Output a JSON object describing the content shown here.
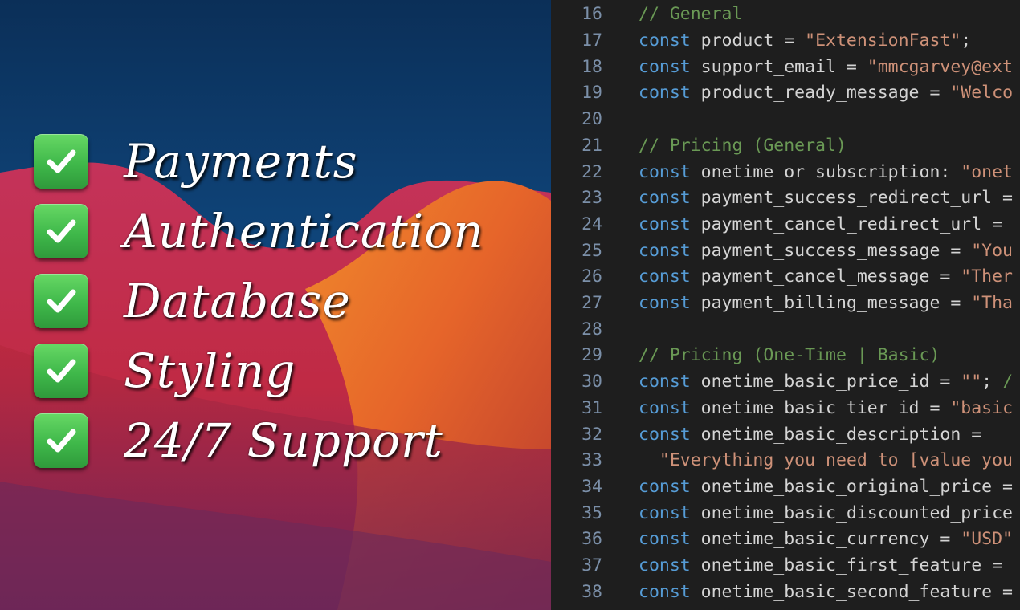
{
  "promo": {
    "features": [
      {
        "label": "Payments",
        "checked": true
      },
      {
        "label": "Authentication",
        "checked": true
      },
      {
        "label": "Database",
        "checked": true
      },
      {
        "label": "Styling",
        "checked": true
      },
      {
        "label": "24/7 Support",
        "checked": true
      }
    ],
    "check_color": "#4cc552"
  },
  "editor": {
    "lines": [
      {
        "num": "16",
        "tokens": [
          {
            "t": "com",
            "v": "// General"
          }
        ]
      },
      {
        "num": "17",
        "tokens": [
          {
            "t": "kw",
            "v": "const "
          },
          {
            "t": "id",
            "v": "product = "
          },
          {
            "t": "str",
            "v": "\"ExtensionFast\""
          },
          {
            "t": "punc",
            "v": ";"
          }
        ]
      },
      {
        "num": "18",
        "tokens": [
          {
            "t": "kw",
            "v": "const "
          },
          {
            "t": "id",
            "v": "support_email = "
          },
          {
            "t": "str",
            "v": "\"mmcgarvey@ext"
          }
        ]
      },
      {
        "num": "19",
        "tokens": [
          {
            "t": "kw",
            "v": "const "
          },
          {
            "t": "id",
            "v": "product_ready_message = "
          },
          {
            "t": "str",
            "v": "\"Welco"
          }
        ]
      },
      {
        "num": "20",
        "tokens": []
      },
      {
        "num": "21",
        "tokens": [
          {
            "t": "com",
            "v": "// Pricing (General)"
          }
        ]
      },
      {
        "num": "22",
        "tokens": [
          {
            "t": "kw",
            "v": "const "
          },
          {
            "t": "id",
            "v": "onetime_or_subscription: "
          },
          {
            "t": "str",
            "v": "\"onet"
          }
        ]
      },
      {
        "num": "23",
        "tokens": [
          {
            "t": "kw",
            "v": "const "
          },
          {
            "t": "id",
            "v": "payment_success_redirect_url ="
          }
        ]
      },
      {
        "num": "24",
        "tokens": [
          {
            "t": "kw",
            "v": "const "
          },
          {
            "t": "id",
            "v": "payment_cancel_redirect_url = "
          }
        ]
      },
      {
        "num": "25",
        "tokens": [
          {
            "t": "kw",
            "v": "const "
          },
          {
            "t": "id",
            "v": "payment_success_message = "
          },
          {
            "t": "str",
            "v": "\"You"
          }
        ]
      },
      {
        "num": "26",
        "tokens": [
          {
            "t": "kw",
            "v": "const "
          },
          {
            "t": "id",
            "v": "payment_cancel_message = "
          },
          {
            "t": "str",
            "v": "\"Ther"
          }
        ]
      },
      {
        "num": "27",
        "tokens": [
          {
            "t": "kw",
            "v": "const "
          },
          {
            "t": "id",
            "v": "payment_billing_message = "
          },
          {
            "t": "str",
            "v": "\"Tha"
          }
        ]
      },
      {
        "num": "28",
        "tokens": []
      },
      {
        "num": "29",
        "tokens": [
          {
            "t": "com",
            "v": "// Pricing (One-Time | Basic)"
          }
        ]
      },
      {
        "num": "30",
        "tokens": [
          {
            "t": "kw",
            "v": "const "
          },
          {
            "t": "id",
            "v": "onetime_basic_price_id = "
          },
          {
            "t": "str",
            "v": "\"\""
          },
          {
            "t": "punc",
            "v": "; "
          },
          {
            "t": "com",
            "v": "/"
          }
        ]
      },
      {
        "num": "31",
        "tokens": [
          {
            "t": "kw",
            "v": "const "
          },
          {
            "t": "id",
            "v": "onetime_basic_tier_id = "
          },
          {
            "t": "str",
            "v": "\"basic"
          }
        ]
      },
      {
        "num": "32",
        "tokens": [
          {
            "t": "kw",
            "v": "const "
          },
          {
            "t": "id",
            "v": "onetime_basic_description ="
          }
        ]
      },
      {
        "num": "33",
        "tokens": [
          {
            "t": "str",
            "v": "  \"Everything you need to [value you"
          }
        ]
      },
      {
        "num": "34",
        "tokens": [
          {
            "t": "kw",
            "v": "const "
          },
          {
            "t": "id",
            "v": "onetime_basic_original_price ="
          }
        ]
      },
      {
        "num": "35",
        "tokens": [
          {
            "t": "kw",
            "v": "const "
          },
          {
            "t": "id",
            "v": "onetime_basic_discounted_price"
          }
        ]
      },
      {
        "num": "36",
        "tokens": [
          {
            "t": "kw",
            "v": "const "
          },
          {
            "t": "id",
            "v": "onetime_basic_currency = "
          },
          {
            "t": "str",
            "v": "\"USD\""
          }
        ]
      },
      {
        "num": "37",
        "tokens": [
          {
            "t": "kw",
            "v": "const "
          },
          {
            "t": "id",
            "v": "onetime_basic_first_feature = "
          }
        ]
      },
      {
        "num": "38",
        "tokens": [
          {
            "t": "kw",
            "v": "const "
          },
          {
            "t": "id",
            "v": "onetime_basic_second_feature ="
          }
        ]
      }
    ],
    "colors": {
      "keyword": "#569cd6",
      "string": "#ce9178",
      "comment": "#6a9955",
      "identifier": "#d4d4d4",
      "line_number": "#7b8fa8"
    }
  }
}
